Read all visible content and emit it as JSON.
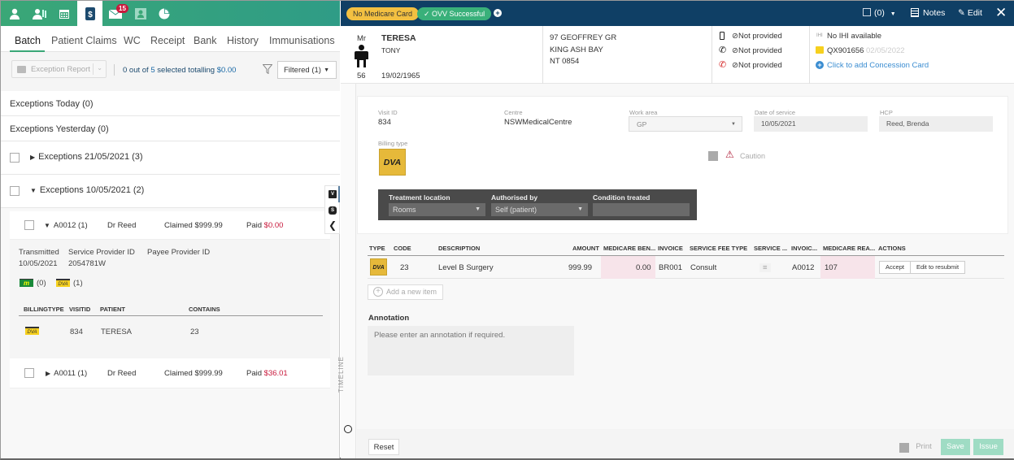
{
  "nav": {
    "icons": [
      "person-icon",
      "patients-icon",
      "calendar-icon",
      "billing-icon",
      "mail-icon",
      "contacts-icon",
      "reports-pie-icon"
    ],
    "mail_badge": "15"
  },
  "tabs": [
    "Batch",
    "Patient Claims",
    "WC",
    "Receipt",
    "Bank",
    "History",
    "Immunisations"
  ],
  "toolbar": {
    "report_label": "Exception Report",
    "sel_prefix": "0 out of ",
    "sel_count": "5",
    "sel_mid": " selected totalling ",
    "sel_total": "$0.00",
    "filter_label": "Filtered (1)"
  },
  "groups": {
    "today": "Exceptions  Today  (0)",
    "yesterday": "Exceptions  Yesterday  (0)",
    "g1": "Exceptions  21/05/2021  (3)",
    "g2": "Exceptions  10/05/2021  (2)"
  },
  "batches": [
    {
      "id": "A0012 (1)",
      "doctor": "Dr Reed",
      "claimed": "Claimed  $999.99",
      "paid_label": "Paid ",
      "paid": "$0.00"
    },
    {
      "id": "A0011 (1)",
      "doctor": "Dr Reed",
      "claimed": "Claimed  $999.99",
      "paid_label": "Paid ",
      "paid": "$36.01"
    }
  ],
  "detail": {
    "transmitted_label": "Transmitted",
    "transmitted": "10/05/2021",
    "spid_label": "Service Provider ID",
    "spid": "2054781W",
    "payee_label": "Payee Provider ID",
    "medicare_count": "(0)",
    "dva_count": "(1)",
    "medicare_logo": "m",
    "dva_logo": "DVA",
    "headers": [
      "BILLINGTYPE",
      "VISITID",
      "PATIENT",
      "CONTAINS"
    ],
    "row": {
      "visit": "834",
      "patient": "TERESA",
      "contains": "23"
    }
  },
  "side_tabs": [
    "V",
    "S"
  ],
  "header": {
    "pill_medicare": "No Medicare Card",
    "pill_ovv": "✓ OVV Successful",
    "appointments": "(0)",
    "notes": "Notes",
    "edit": "Edit"
  },
  "patient": {
    "title": "Mr",
    "surname": "TERESA",
    "given": "TONY",
    "age": "56",
    "dob": "19/02/1965",
    "address1": "97 GEOFFREY GR",
    "address2": "KING ASH BAY",
    "address3": "NT 0854",
    "mobile": "Not provided",
    "phone": "Not provided",
    "emergency": "Not provided",
    "ihi": "No IHI available",
    "dva_no": "QX901656",
    "dva_expiry": "02/05/2022",
    "concession": "Click to add Concession Card"
  },
  "visit": {
    "visit_id_label": "Visit ID",
    "visit_id": "834",
    "centre_label": "Centre",
    "centre": "NSWMedicalCentre",
    "work_area_label": "Work area",
    "work_area": "GP",
    "dos_label": "Date of service",
    "dos": "10/05/2021",
    "hcp_label": "HCP",
    "hcp": "Reed, Brenda",
    "billing_label": "Billing type",
    "billing": "DVA",
    "caution": "Caution",
    "treatment_label": "Treatment location",
    "treatment": "Rooms",
    "authorised_label": "Authorised by",
    "authorised": "Self (patient)",
    "condition_label": "Condition treated",
    "condition": ""
  },
  "items": {
    "headers": [
      "TYPE",
      "CODE",
      "DESCRIPTION",
      "AMOUNT",
      "MEDICARE BEN...",
      "INVOICE",
      "SERVICE FEE TYPE",
      "SERVICE ...",
      "INVOIC...",
      "MEDICARE REA...",
      "ACTIONS"
    ],
    "rows": [
      {
        "type": "DVA",
        "code": "23",
        "description": "Level B Surgery",
        "amount": "999.99",
        "medicare_benefit": "0.00",
        "invoice": "BR001",
        "service_fee_type": "Consult",
        "service": "≡",
        "invoice2": "A0012",
        "medicare_reason": "107",
        "accept": "Accept",
        "resubmit": "Edit to resubmit"
      }
    ],
    "add_label": "Add a new item"
  },
  "annotation": {
    "label": "Annotation",
    "placeholder": "Please enter an annotation if required."
  },
  "timeline_label": "TIMELINE",
  "footer": {
    "reset": "Reset",
    "print": "Print",
    "save": "Save",
    "issue": "Issue"
  }
}
